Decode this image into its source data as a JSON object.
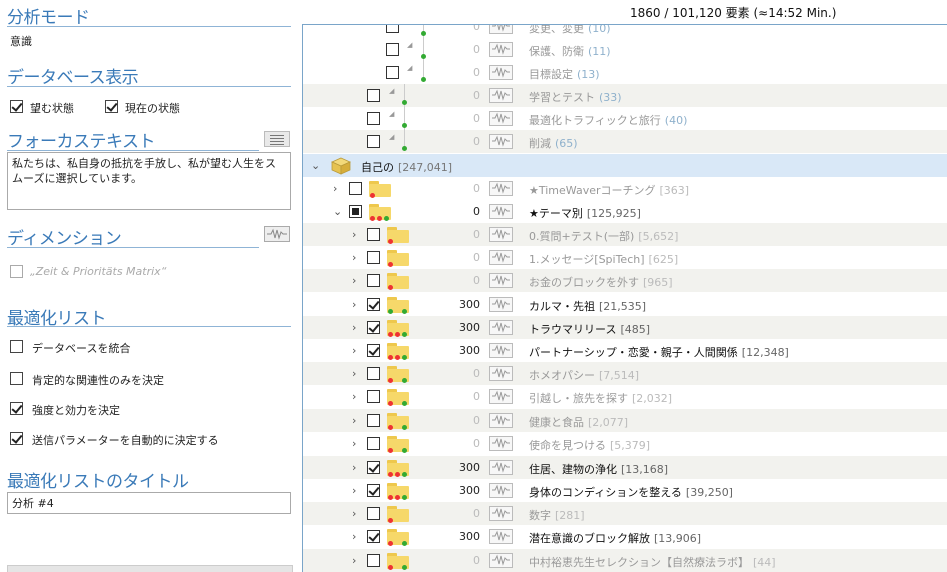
{
  "status": "1860 / 101,120 要素 (≈14:52 Min.)",
  "left": {
    "mode_title": "分析モード",
    "mode_value": "意識",
    "db_title": "データベース表示",
    "db_opt1": "望む状態",
    "db_opt2": "現在の状態",
    "focus_title": "フォーカステキスト",
    "focus_text": "私たちは、私自身の抵抗を手放し、私が望む人生をスムーズに選択しています。",
    "dim_title": "ディメンション",
    "dim_opt": "„Zeit & Prioritäts Matrix“",
    "opt_title": "最適化リスト",
    "opt1": "データベースを統合",
    "opt2": "肯定的な関連性のみを決定",
    "opt3": "強度と効力を決定",
    "opt4": "送信パラメーターを自動的に決定する",
    "optlist_title": "最適化リストのタイトル",
    "optlist_value": "分析 #4"
  },
  "rows": [
    {
      "label": "変更、変更",
      "count": "(10)",
      "num": "0"
    },
    {
      "label": "保護、防衛",
      "count": "(11)",
      "num": "0"
    },
    {
      "label": "目標設定",
      "count": "(13)",
      "num": "0"
    },
    {
      "label": "学習とテスト",
      "count": "(33)",
      "num": "0"
    },
    {
      "label": "最適化トラフィックと旅行",
      "count": "(40)",
      "num": "0"
    },
    {
      "label": "削減",
      "count": "(65)",
      "num": "0"
    },
    {
      "label": "自己の",
      "count": "[247,041]"
    },
    {
      "label": "★TimeWaverコーチング",
      "count": "[363]",
      "num": "0"
    },
    {
      "label": "★テーマ別",
      "count": "[125,925]",
      "num": "0"
    },
    {
      "label": "0.質問+テスト(一部)",
      "count": "[5,652]",
      "num": "0"
    },
    {
      "label": "1.メッセージ[SpiTech]",
      "count": "[625]",
      "num": "0"
    },
    {
      "label": "お金のブロックを外す",
      "count": "[965]",
      "num": "0"
    },
    {
      "label": "カルマ・先祖",
      "count": "[21,535]",
      "num": "300"
    },
    {
      "label": "トラウマリリース",
      "count": "[485]",
      "num": "300"
    },
    {
      "label": "パートナーシップ・恋愛・親子・人間関係",
      "count": "[12,348]",
      "num": "300"
    },
    {
      "label": "ホメオパシー",
      "count": "[7,514]",
      "num": "0"
    },
    {
      "label": "引越し・旅先を探す",
      "count": "[2,032]",
      "num": "0"
    },
    {
      "label": "健康と食品",
      "count": "[2,077]",
      "num": "0"
    },
    {
      "label": "使命を見つける",
      "count": "[5,379]",
      "num": "0"
    },
    {
      "label": "住居、建物の浄化",
      "count": "[13,168]",
      "num": "300"
    },
    {
      "label": "身体のコンディションを整える",
      "count": "[39,250]",
      "num": "300"
    },
    {
      "label": "数字",
      "count": "[281]",
      "num": "0"
    },
    {
      "label": "潜在意識のブロック解放",
      "count": "[13,906]",
      "num": "300"
    },
    {
      "label": "中村裕恵先生セレクション【自然療法ラボ】",
      "count": "[44]",
      "num": "0"
    }
  ]
}
